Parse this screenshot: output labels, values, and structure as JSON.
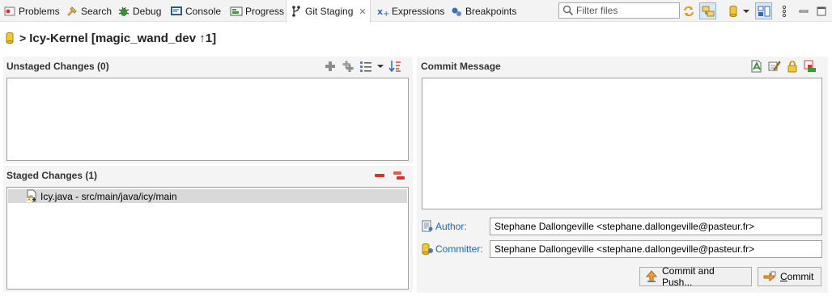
{
  "tabs": [
    {
      "label": "Problems",
      "icon": "problems-icon"
    },
    {
      "label": "Search",
      "icon": "search-icon"
    },
    {
      "label": "Debug",
      "icon": "debug-icon"
    },
    {
      "label": "Console",
      "icon": "console-icon"
    },
    {
      "label": "Progress",
      "icon": "progress-icon"
    },
    {
      "label": "Git Staging",
      "icon": "git-staging-icon",
      "active": true
    },
    {
      "label": "Expressions",
      "icon": "expressions-icon"
    },
    {
      "label": "Breakpoints",
      "icon": "breakpoints-icon"
    }
  ],
  "filter": {
    "placeholder": "Filter files"
  },
  "repo": {
    "title": "Icy-Kernel [magic_wand_dev ↑1]"
  },
  "unstaged": {
    "heading": "Unstaged Changes (0)"
  },
  "staged": {
    "heading": "Staged Changes (1)",
    "files": [
      {
        "label": "Icy.java - src/main/java/icy/main"
      }
    ]
  },
  "commit": {
    "heading": "Commit Message",
    "message": "",
    "author_label": "Author:",
    "author_value": "Stephane Dallongeville <stephane.dallongeville@pasteur.fr>",
    "committer_label": "Committer:",
    "committer_value": "Stephane Dallongeville <stephane.dallongeville@pasteur.fr>",
    "commit_push_label": "Commit and Push...",
    "commit_label_prefix": "",
    "commit_label_mnemonic": "C",
    "commit_label_rest": "ommit"
  },
  "colors": {
    "accent_blue": "#1e64b4",
    "remove_red": "#d9302a",
    "add_gray": "#8c8c8c"
  }
}
